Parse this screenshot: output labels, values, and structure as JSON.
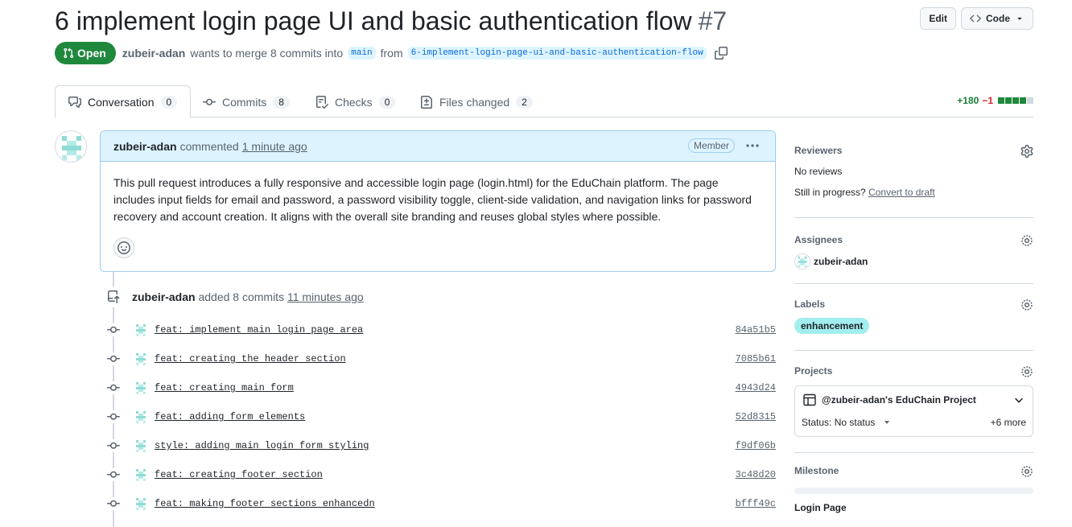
{
  "pr": {
    "title": "6 implement login page UI and basic authentication flow",
    "number": "#7",
    "state": "Open",
    "author": "zubeir-adan",
    "merge_text": "wants to merge 8 commits into",
    "base_branch": "main",
    "from_text": "from",
    "head_branch": "6-implement-login-page-ui-and-basic-authentication-flow"
  },
  "header_actions": {
    "edit_label": "Edit",
    "code_label": "Code"
  },
  "tabs": [
    {
      "label": "Conversation",
      "count": "0"
    },
    {
      "label": "Commits",
      "count": "8"
    },
    {
      "label": "Checks",
      "count": "0"
    },
    {
      "label": "Files changed",
      "count": "2"
    }
  ],
  "diffstat": {
    "additions": "+180",
    "deletions": "−1",
    "blocks": [
      "#1f883d",
      "#1f883d",
      "#1f883d",
      "#1f883d",
      "#d1d9e0"
    ]
  },
  "comment": {
    "author": "zubeir-adan",
    "verb": "commented",
    "time": "1 minute ago",
    "role": "Member",
    "body": "This pull request introduces a fully responsive and accessible login page (login.html) for the EduChain platform. The page includes input fields for email and password, a password visibility toggle, client-side validation, and navigation links for password recovery and account creation. It aligns with the overall site branding and reuses global styles where possible."
  },
  "push_event": {
    "author": "zubeir-adan",
    "text": "added 8 commits",
    "time": "11 minutes ago"
  },
  "commits": [
    {
      "message": "feat: implement main login page area",
      "sha": "84a51b5"
    },
    {
      "message": "feat: creating the header section",
      "sha": "7085b61"
    },
    {
      "message": "feat: creating main form",
      "sha": "4943d24"
    },
    {
      "message": "feat: adding form elements",
      "sha": "52d8315"
    },
    {
      "message": "style: adding main login form styling",
      "sha": "f9df06b"
    },
    {
      "message": "feat: creating footer section",
      "sha": "3c48d20"
    },
    {
      "message": "feat: making footer sections enhancedn",
      "sha": "bfff49c"
    }
  ],
  "sidebar": {
    "reviewers": {
      "title": "Reviewers",
      "value": "No reviews",
      "progress_text": "Still in progress?",
      "progress_link": "Convert to draft"
    },
    "assignees": {
      "title": "Assignees",
      "value": "zubeir-adan"
    },
    "labels": {
      "title": "Labels",
      "value": "enhancement"
    },
    "projects": {
      "title": "Projects",
      "project_name": "@zubeir-adan's EduChain Project",
      "status": "Status: No status",
      "more": "+6 more"
    },
    "milestone": {
      "title": "Milestone",
      "value": "Login Page"
    }
  },
  "colors": {
    "accent": "#0969da",
    "open_green": "#1f883d",
    "comment_border": "#9ecbf0",
    "comment_header": "#ddf4ff",
    "label_bg": "#a2eeef"
  }
}
